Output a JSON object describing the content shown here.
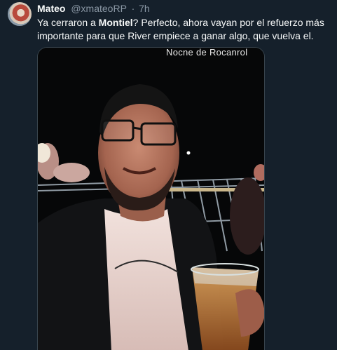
{
  "tweet": {
    "author_name": "Mateo",
    "author_handle": "@xmateoRP",
    "separator": "·",
    "time": "7h",
    "text_before": "Ya cerraron a ",
    "text_bold": "Montiel",
    "text_after": "? Perfecto, ahora vayan por el refuerzo más importante para que River empiece a ganar algo, que vuelva el.",
    "media": {
      "overlay_text": "Nocne de Rocanrol",
      "icon": "photo"
    }
  },
  "colors": {
    "background": "#15202b",
    "text_primary": "#f7f9f9",
    "text_secondary": "#8b98a5",
    "border": "#38444d"
  }
}
